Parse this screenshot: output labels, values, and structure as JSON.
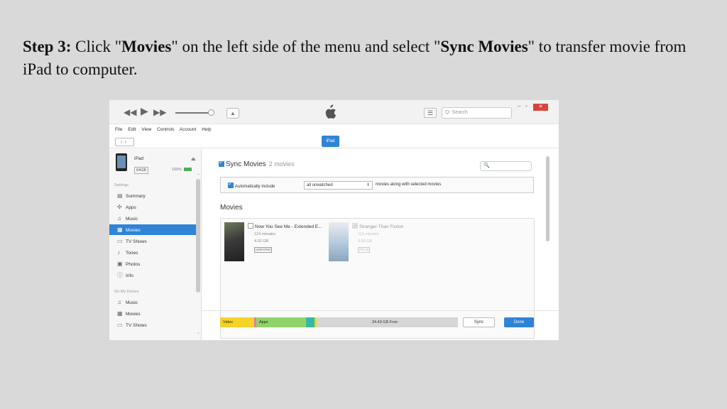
{
  "caption": {
    "step": "Step 3:",
    "t1": " Click \"",
    "movies": "Movies",
    "t2": "\" on the left side of the menu and select \"",
    "sync_movies": "Sync Movies",
    "t3": "\" to transfer movie from iPad to computer."
  },
  "toolbar": {
    "rewind": "◀◀",
    "play": "▶",
    "forward": "▶▶",
    "search_placeholder": "Q- Search"
  },
  "menu": [
    "File",
    "Edit",
    "View",
    "Controls",
    "Account",
    "Help"
  ],
  "nav": {
    "device_tab": "iPad"
  },
  "device": {
    "name": "iPad",
    "capacity": "64GB",
    "battery": "100%"
  },
  "sidebar": {
    "settings_header": "Settings",
    "settings_items": [
      {
        "label": "Summary",
        "icon": "summary-icon"
      },
      {
        "label": "Apps",
        "icon": "apps-icon"
      },
      {
        "label": "Music",
        "icon": "music-icon"
      },
      {
        "label": "Movies",
        "icon": "movies-icon",
        "selected": true
      },
      {
        "label": "TV Shows",
        "icon": "tv-icon"
      },
      {
        "label": "Tones",
        "icon": "bell-icon"
      },
      {
        "label": "Photos",
        "icon": "camera-icon"
      },
      {
        "label": "Info",
        "icon": "info-icon"
      }
    ],
    "ondevice_header": "On My Device",
    "ondevice_items": [
      {
        "label": "Music",
        "icon": "music-icon"
      },
      {
        "label": "Movies",
        "icon": "movies-icon"
      },
      {
        "label": "TV Shows",
        "icon": "tv-icon"
      }
    ]
  },
  "main": {
    "sync_label": "Sync Movies",
    "sync_count": "2 movies",
    "sync_checked": true,
    "auto_label": "Automatically include",
    "auto_value": "all unwatched",
    "auto_tail": "movies along with selected movies",
    "movies_header": "Movies",
    "movies": [
      {
        "title": "Now You See Me - Extended E...",
        "duration": "124 minutes",
        "size": "4.02 GB",
        "badge": "UNRATED",
        "checked": false
      },
      {
        "title": "Stranger Than Fiction",
        "duration": "113 minutes",
        "size": "3.63 GB",
        "badge": "PG-13",
        "checked": true
      }
    ]
  },
  "capacity": {
    "video_label": "Video",
    "apps_label": "Apps",
    "free_label": "34.43 GB Free",
    "colors": {
      "video": "#f5d327",
      "other": "#e377c2",
      "apps": "#8fd46a",
      "teal": "#35b7a8"
    }
  },
  "buttons": {
    "sync": "Sync",
    "done": "Done"
  },
  "colors": {
    "accent": "#2f84d8",
    "close": "#d9453d"
  }
}
